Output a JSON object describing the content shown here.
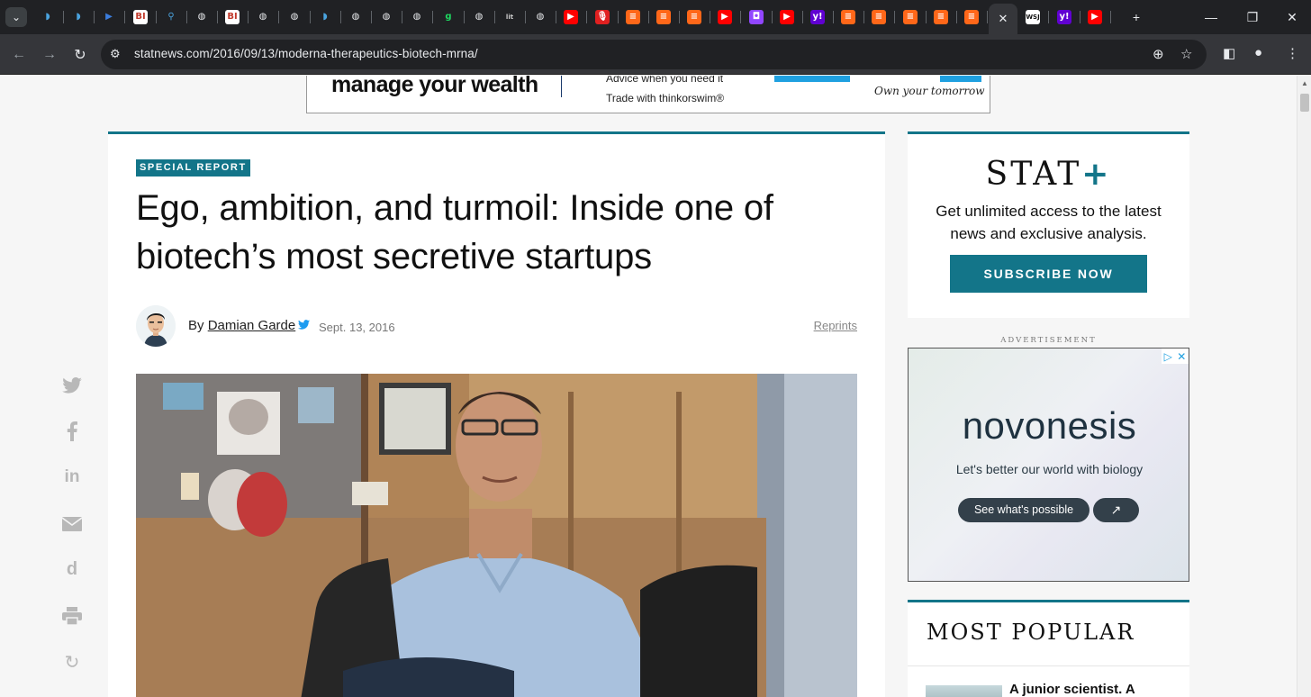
{
  "browser": {
    "url": "statnews.com/2016/09/13/moderna-therapeutics-biotech-mrna/",
    "tabs": [
      {
        "icon": "shield-favicon",
        "glyph": "◗",
        "bg": "#202124",
        "fg": "#4aa3df"
      },
      {
        "icon": "shield-favicon",
        "glyph": "◗",
        "bg": "#202124",
        "fg": "#4aa3df"
      },
      {
        "icon": "flag-favicon",
        "glyph": "▶",
        "bg": "#202124",
        "fg": "#3b7ddd"
      },
      {
        "icon": "bi-favicon",
        "glyph": "BI",
        "bg": "#ffffff",
        "fg": "#c0392b"
      },
      {
        "icon": "search-favicon",
        "glyph": "⚲",
        "bg": "#202124",
        "fg": "#4aa3df"
      },
      {
        "icon": "globe-favicon",
        "glyph": "◍",
        "bg": "#202124",
        "fg": "#e8eaed"
      },
      {
        "icon": "bi-favicon",
        "glyph": "BI",
        "bg": "#ffffff",
        "fg": "#c0392b"
      },
      {
        "icon": "globe-favicon",
        "glyph": "◍",
        "bg": "#202124",
        "fg": "#e8eaed"
      },
      {
        "icon": "globe-favicon",
        "glyph": "◍",
        "bg": "#202124",
        "fg": "#e8eaed"
      },
      {
        "icon": "shield-favicon",
        "glyph": "◗",
        "bg": "#202124",
        "fg": "#4aa3df"
      },
      {
        "icon": "globe-favicon",
        "glyph": "◍",
        "bg": "#202124",
        "fg": "#e8eaed"
      },
      {
        "icon": "globe-favicon",
        "glyph": "◍",
        "bg": "#202124",
        "fg": "#e8eaed"
      },
      {
        "icon": "globe-favicon",
        "glyph": "◍",
        "bg": "#202124",
        "fg": "#e8eaed"
      },
      {
        "icon": "g-favicon",
        "glyph": "g",
        "bg": "#202124",
        "fg": "#1ed760"
      },
      {
        "icon": "globe-favicon",
        "glyph": "◍",
        "bg": "#202124",
        "fg": "#e8eaed"
      },
      {
        "icon": "lit-favicon",
        "glyph": "lit",
        "bg": "#202124",
        "fg": "#cccccc"
      },
      {
        "icon": "globe-favicon",
        "glyph": "◍",
        "bg": "#202124",
        "fg": "#e8eaed"
      },
      {
        "icon": "youtube-favicon",
        "glyph": "▶",
        "bg": "#ff0000",
        "fg": "#ffffff"
      },
      {
        "icon": "podcast-favicon",
        "glyph": "🎙",
        "bg": "#e02020",
        "fg": "#ffffff"
      },
      {
        "icon": "substack-favicon",
        "glyph": "≡",
        "bg": "#ff6719",
        "fg": "#ffffff"
      },
      {
        "icon": "substack-favicon",
        "glyph": "≡",
        "bg": "#ff6719",
        "fg": "#ffffff"
      },
      {
        "icon": "substack-favicon",
        "glyph": "≡",
        "bg": "#ff6719",
        "fg": "#ffffff"
      },
      {
        "icon": "youtube-favicon",
        "glyph": "▶",
        "bg": "#ff0000",
        "fg": "#ffffff"
      },
      {
        "icon": "twitch-favicon",
        "glyph": "◘",
        "bg": "#9146ff",
        "fg": "#ffffff"
      },
      {
        "icon": "youtube-favicon",
        "glyph": "▶",
        "bg": "#ff0000",
        "fg": "#ffffff"
      },
      {
        "icon": "yahoo-favicon",
        "glyph": "y!",
        "bg": "#6001d2",
        "fg": "#ffffff"
      },
      {
        "icon": "substack-favicon",
        "glyph": "≡",
        "bg": "#ff6719",
        "fg": "#ffffff"
      },
      {
        "icon": "substack-favicon",
        "glyph": "≡",
        "bg": "#ff6719",
        "fg": "#ffffff"
      },
      {
        "icon": "substack-favicon",
        "glyph": "≡",
        "bg": "#ff6719",
        "fg": "#ffffff"
      },
      {
        "icon": "substack-favicon",
        "glyph": "≡",
        "bg": "#ff6719",
        "fg": "#ffffff"
      },
      {
        "icon": "substack-favicon",
        "glyph": "≡",
        "bg": "#ff6719",
        "fg": "#ffffff"
      },
      {
        "icon": "close-icon",
        "glyph": "✕",
        "bg": "transparent",
        "fg": "#e8eaed",
        "active": true
      },
      {
        "icon": "wsj-favicon",
        "glyph": "WSJ",
        "bg": "#ffffff",
        "fg": "#111111"
      },
      {
        "icon": "yahoo-favicon",
        "glyph": "y!",
        "bg": "#6001d2",
        "fg": "#ffffff"
      },
      {
        "icon": "youtube-favicon",
        "glyph": "▶",
        "bg": "#ff0000",
        "fg": "#ffffff"
      }
    ]
  },
  "top_ad": {
    "headline": "manage your wealth",
    "line1": "Advice when you need it",
    "line2": "Trade with thinkorswim®",
    "tagline": "Own your tomorrow"
  },
  "article": {
    "badge": "SPECIAL REPORT",
    "title": "Ego, ambition, and turmoil: Inside one of biotech’s most secretive startups",
    "by": "By ",
    "author": "Damian Garde",
    "date": "Sept. 13, 2016",
    "reprints": "Reprints"
  },
  "sidebar": {
    "stat_logo": "STAT",
    "stat_plus": "+",
    "stat_sub": "Get unlimited access to the latest news and exclusive analysis.",
    "subscribe": "SUBSCRIBE NOW",
    "ad_label": "ADVERTISEMENT",
    "ad_brand": "novonesis",
    "ad_tagline": "Let's better our world with biology",
    "ad_button": "See what's possible",
    "popular_title": "MOST POPULAR",
    "popular_first": "A junior scientist. A"
  },
  "colors": {
    "accent": "#137589",
    "chrome_dark": "#202124",
    "chrome_mid": "#35363a"
  }
}
